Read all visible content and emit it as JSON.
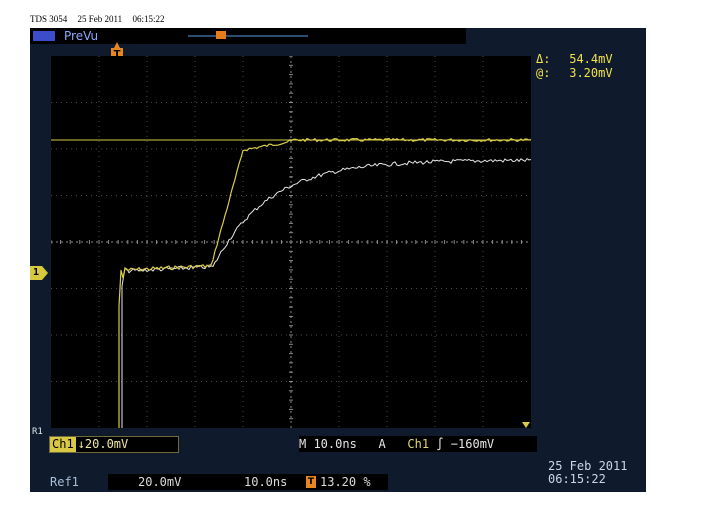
{
  "caption": {
    "model": "TDS 3054",
    "date": "25 Feb 2011",
    "time": "06:15:22"
  },
  "header": {
    "mode_label": "PreVu",
    "trigger_icon": "trigger-position-icon",
    "trigger_glyph": "T"
  },
  "cursor_readout": {
    "delta_label": "Δ:",
    "delta_value": "54.4mV",
    "at_label": "@:",
    "at_value": "3.20mV"
  },
  "markers": {
    "ch1_glyph": "1",
    "ref1_glyph": "R1"
  },
  "status": {
    "channel_name": "Ch1",
    "channel_scale": "↓20.0mV",
    "timebase": "M 10.0ns",
    "trigger_mode": "A",
    "trigger_channel": "Ch1",
    "trigger_slope": "∫",
    "trigger_level": "−160mV"
  },
  "reference": {
    "name": "Ref1",
    "scale": "20.0mV",
    "timebase": "10.0ns",
    "trigger_glyph": "T",
    "position": "13.20 %"
  },
  "datetime": {
    "date": "25 Feb  2011",
    "time": "06:15:22"
  },
  "colors": {
    "ch1": "#d8cc48",
    "ref1": "#e6e6e6",
    "grid": "#4a4a4a",
    "screen": "#000000",
    "bezel": "#0f1b2c"
  },
  "waveform": {
    "ch1_trace": "fast step, settles near top grid level",
    "ref1_trace": "slower step, settles below Ch1"
  }
}
